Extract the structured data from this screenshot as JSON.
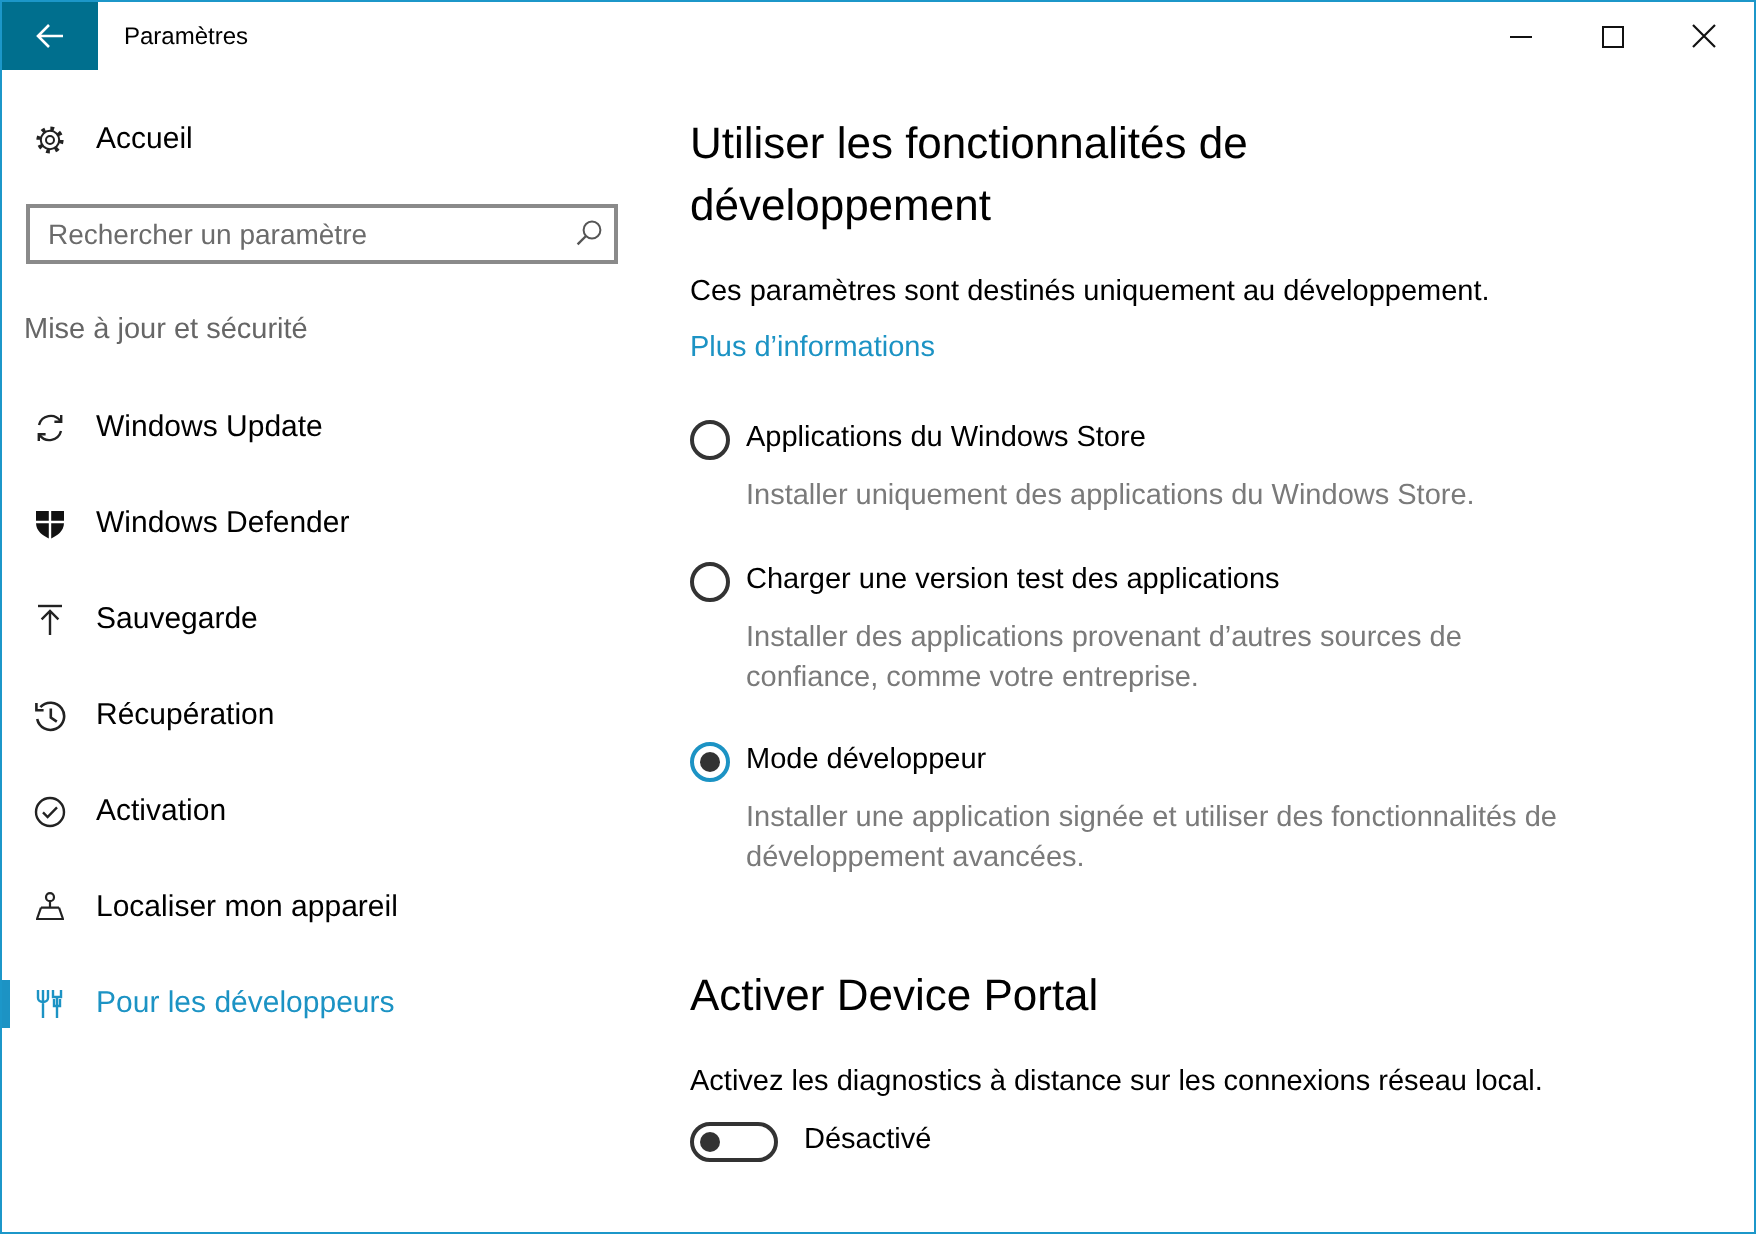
{
  "window": {
    "title": "Paramètres"
  },
  "sidebar": {
    "home": {
      "label": "Accueil"
    },
    "search": {
      "placeholder": "Rechercher un paramètre"
    },
    "section_title": "Mise à jour et sécurité",
    "items": [
      {
        "label": "Windows Update",
        "selected": false
      },
      {
        "label": "Windows Defender",
        "selected": false
      },
      {
        "label": "Sauvegarde",
        "selected": false
      },
      {
        "label": "Récupération",
        "selected": false
      },
      {
        "label": "Activation",
        "selected": false
      },
      {
        "label": "Localiser mon appareil",
        "selected": false
      },
      {
        "label": "Pour les développeurs",
        "selected": true
      }
    ]
  },
  "developer_features": {
    "heading": "Utiliser les fonctionnalités de développement",
    "description": "Ces paramètres sont destinés uniquement au développement.",
    "link": "Plus d’informations",
    "options": [
      {
        "label": "Applications du Windows Store",
        "description": "Installer uniquement des applications du Windows Store.",
        "selected": false
      },
      {
        "label": "Charger une version test des applications",
        "description": "Installer des applications provenant d’autres sources de confiance, comme votre entreprise.",
        "selected": false
      },
      {
        "label": "Mode développeur",
        "description": "Installer une application signée et utiliser des fonctionnalités de développement avancées.",
        "selected": true
      }
    ]
  },
  "device_portal": {
    "heading": "Activer Device Portal",
    "description": "Activez les diagnostics à distance sur les connexions réseau local.",
    "toggle": {
      "on": false,
      "label": "Désactivé"
    }
  }
}
